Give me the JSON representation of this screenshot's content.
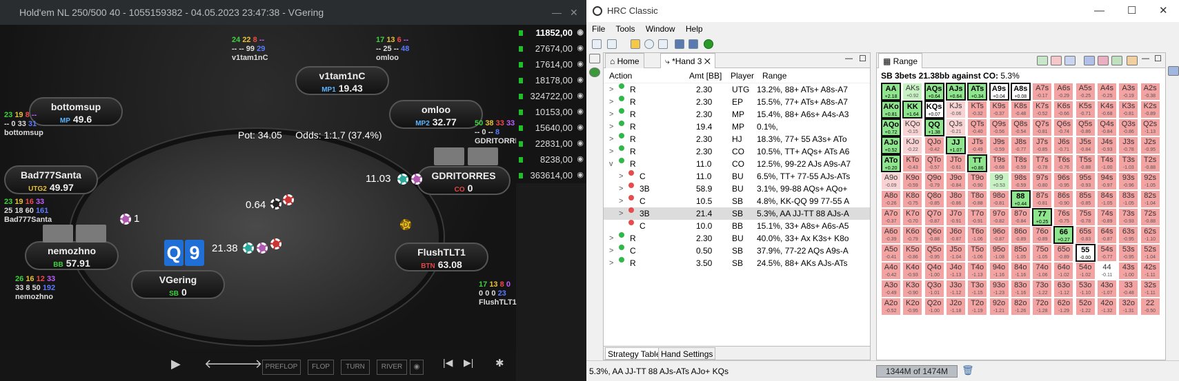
{
  "poker": {
    "title": "Hold'em NL 250/500 40 - 1055159382 - 04.05.2023 23:47:38 - VGering",
    "win_min": "—",
    "win_close": "✕",
    "pot_label": "Pot:  34.05",
    "odds_label": "Odds:  1:1.7 (37.4%)",
    "seats": [
      {
        "name": "v1tam1nC",
        "pos": "MP1",
        "stack": "19.43"
      },
      {
        "name": "omloo",
        "pos": "MP2",
        "stack": "32.77"
      },
      {
        "name": "bottomsup",
        "pos": "MP",
        "stack": "49.6"
      },
      {
        "name": "Bad777Santa",
        "pos": "UTG2",
        "stack": "49.97"
      },
      {
        "name": "GDRITORRES",
        "pos": "CO",
        "stack": "0"
      },
      {
        "name": "nemozhno",
        "pos": "BB",
        "stack": "57.91"
      },
      {
        "name": "VGering",
        "pos": "SB",
        "stack": "0"
      },
      {
        "name": "FlushTLT1",
        "pos": "BTN",
        "stack": "63.08"
      }
    ],
    "stats": {
      "v1tam1nC": {
        "a": "24",
        "b": "22",
        "c": "8",
        "d": "--",
        "e": "--",
        "f": "--",
        "g": "99",
        "h": "29",
        "name": "v1tam1nC"
      },
      "omloo": {
        "a": "17",
        "b": "13",
        "c": "6",
        "d": "--",
        "e": "--",
        "f": "25",
        "g": "--",
        "h": "48",
        "name": "omloo"
      },
      "bottomsup": {
        "a": "23",
        "b": "19",
        "c": "8",
        "d": "--",
        "e": "--",
        "f": "0",
        "g": "33",
        "h": "31",
        "name": "bottomsup"
      },
      "gdri": {
        "a": "50",
        "b": "38",
        "c": "33",
        "d": "33",
        "e": "--",
        "f": "0",
        "g": "--",
        "h": "8",
        "name": "GDRITORRES"
      },
      "bad": {
        "a": "23",
        "b": "19",
        "c": "16",
        "d": "33",
        "e": "25",
        "f": "18",
        "g": "60",
        "h": "161",
        "name": "Bad777Santa"
      },
      "nemo": {
        "a": "26",
        "b": "16",
        "c": "12",
        "d": "33",
        "e": "33",
        "f": "8",
        "g": "50",
        "h": "192",
        "name": "nemozhno"
      },
      "flush": {
        "a": "17",
        "b": "13",
        "c": "8",
        "d": "0",
        "e": "0",
        "f": "0",
        "g": "0",
        "h": "23",
        "name": "FlushTLT1"
      }
    },
    "bets": {
      "gdri": "11.03",
      "center": "0.64",
      "bad": "1",
      "vg": "21.38"
    },
    "hole_cards": [
      "Q",
      "9"
    ],
    "stack_list": [
      "11852,00",
      "27674,00",
      "17614,00",
      "18178,00",
      "324722,00",
      "10153,00",
      "15640,00",
      "22831,00",
      "8238,00",
      "363614,00"
    ],
    "controls": {
      "play": "▶",
      "back": "🡐",
      "fwd": "🡒",
      "preflop": "PREFLOP",
      "flop": "FLOP",
      "turn": "TURN",
      "river": "RIVER",
      "eye": "◉",
      "first": "|◀",
      "last": "▶|",
      "gear": "✱"
    },
    "dealer_button": "D"
  },
  "hrc": {
    "title": "HRC Classic",
    "win_min": "—",
    "win_max": "☐",
    "win_close": "✕",
    "menu": [
      "File",
      "Tools",
      "Window",
      "Help"
    ],
    "tabs": {
      "home": "Home",
      "hand": "*Hand 3",
      "close": "✕",
      "range": "Range"
    },
    "columns": [
      "Action",
      "Amt [BB]",
      "Player",
      "Range"
    ],
    "rows": [
      {
        "exp": ">",
        "dot": "green",
        "act": "R",
        "amt": "2.30",
        "pl": "UTG",
        "rng": "13.2%, 88+ ATs+ A8s-A7"
      },
      {
        "exp": ">",
        "dot": "green",
        "act": "R",
        "amt": "2.30",
        "pl": "EP",
        "rng": "15.5%, 77+ ATs+ A8s-A7"
      },
      {
        "exp": ">",
        "dot": "green",
        "act": "R",
        "amt": "2.30",
        "pl": "MP",
        "rng": "15.4%, 88+ A6s+ A4s-A3"
      },
      {
        "exp": ">",
        "dot": "green",
        "act": "R",
        "amt": "19.4",
        "pl": "MP",
        "rng": "0.1%,"
      },
      {
        "exp": ">",
        "dot": "green",
        "act": "R",
        "amt": "2.30",
        "pl": "HJ",
        "rng": "18.3%, 77+ 55 A3s+ ATo"
      },
      {
        "exp": ">",
        "dot": "green",
        "act": "R",
        "amt": "2.30",
        "pl": "CO",
        "rng": "10.5%, TT+ AQs+ ATs A6"
      },
      {
        "exp": "v",
        "dot": "green",
        "act": "R",
        "amt": "11.0",
        "pl": "CO",
        "rng": "12.5%, 99-22 AJs A9s-A7"
      },
      {
        "exp": ">",
        "dot": "red",
        "act": "C",
        "amt": "11.0",
        "pl": "BU",
        "rng": "6.5%, TT+ 77-55 AJs-ATs",
        "ind": 1
      },
      {
        "exp": ">",
        "dot": "red",
        "act": "3B",
        "amt": "58.9",
        "pl": "BU",
        "rng": "3.1%, 99-88 AQs+ AQo+",
        "ind": 1
      },
      {
        "exp": ">",
        "dot": "red",
        "act": "C",
        "amt": "10.5",
        "pl": "SB",
        "rng": "4.8%, KK-QQ 99 77-55 A",
        "ind": 1
      },
      {
        "exp": ">",
        "dot": "red",
        "act": "3B",
        "amt": "21.4",
        "pl": "SB",
        "rng": "5.3%, AA JJ-TT 88 AJs-A",
        "ind": 1,
        "sel": true
      },
      {
        "exp": "",
        "dot": "red",
        "act": "C",
        "amt": "10.0",
        "pl": "BB",
        "rng": "15.1%, 33+ A8s+ A6s-A5",
        "ind": 1
      },
      {
        "exp": ">",
        "dot": "green",
        "act": "R",
        "amt": "2.30",
        "pl": "BU",
        "rng": "40.0%, 33+ Ax K3s+ K8o"
      },
      {
        "exp": ">",
        "dot": "green",
        "act": "C",
        "amt": "0.50",
        "pl": "SB",
        "rng": "37.9%, 77-22 AQs A9s-A"
      },
      {
        "exp": ">",
        "dot": "green",
        "act": "R",
        "amt": "3.50",
        "pl": "SB",
        "rng": "24.5%, 88+ AKs AJs-ATs"
      }
    ],
    "bottom_tabs": [
      "Strategy Table",
      "Hand Settings"
    ],
    "range_title": "SB 3bets 21.38bb against CO:",
    "range_pct": "5.3%",
    "status": "5.3%, AA JJ-TT 88 AJs-ATs AJo+ KQs",
    "memory": "1344M of 1474M",
    "grid": [
      [
        "AA|+2.18|g",
        "AKs|+0.92|lg",
        "AQs|+0.64|g",
        "AJs|+0.64|g",
        "ATs|+0.34|g",
        "A9s|+0.04|w",
        "A8s|+0.08|w",
        "A7s|-0.17|p",
        "A6s|-0.29|p",
        "A5s|-0.25|p",
        "A4s|-0.25|p",
        "A3s|-0.19|p",
        "A2s|-0.38|p"
      ],
      [
        "AKo|+0.81|g",
        "KK|+1.64|g",
        "KQs|+0.07|w",
        "KJs|-0.06|lp",
        "KTs|-0.32|p",
        "K9s|-0.37|p",
        "K8s|-0.48|p",
        "K7s|-0.52|p",
        "K6s|-0.66|p",
        "K5s|-0.71|p",
        "K4s|-0.68|p",
        "K3s|-0.81|p",
        "K2s|-0.89|p"
      ],
      [
        "AQo|+0.72|g",
        "KQo|-0.15|lp",
        "QQ|+1.38|g",
        "QJs|-0.21|lp",
        "QTs|-0.40|p",
        "Q9s|-0.56|p",
        "Q8s|-0.54|p",
        "Q7s|-0.81|p",
        "Q6s|-0.74|p",
        "Q5s|-0.86|p",
        "Q4s|-0.84|p",
        "Q3s|-0.86|p",
        "Q2s|-1.13|p"
      ],
      [
        "AJo|+0.52|g",
        "KJo|-0.22|lp",
        "QJo|-0.42|p",
        "JJ|+1.07|g",
        "JTs|-0.49|p",
        "J9s|-0.59|p",
        "J8s|-0.77|p",
        "J7s|-0.85|p",
        "J6s|-0.71|p",
        "J5s|-0.84|p",
        "J4s|-0.93|p",
        "J3s|-0.78|p",
        "J2s|-0.95|p"
      ],
      [
        "ATo|+0.20|g",
        "KTo|-0.43|p",
        "QTo|-0.57|p",
        "JTo|-0.61|p",
        "TT|+0.86|g",
        "T9s|-0.68|p",
        "T8s|-0.59|p",
        "T7s|-0.78|p",
        "T6s|-0.76|p",
        "T5s|-0.88|p",
        "T4s|-1.00|p",
        "T3s|-1.03|p",
        "T2s|-0.88|p"
      ],
      [
        "A9o|-0.09|lp",
        "K9o|-0.59|p",
        "Q9o|-0.79|p",
        "J9o|-0.84|p",
        "T9o|-0.90|p",
        "99|+0.53|lg",
        "98s|-0.59|p",
        "97s|-0.80|p",
        "96s|-0.95|p",
        "95s|-0.93|p",
        "94s|-0.97|p",
        "93s|-0.96|p",
        "92s|-1.05|p"
      ],
      [
        "A8o|-0.26|p",
        "K8o|-0.75|p",
        "Q8o|-0.85|p",
        "J8o|-0.86|p",
        "T8o|-0.88|p",
        "98o|-0.81|p",
        "88|+0.44|g",
        "87s|-0.81|p",
        "86s|-0.90|p",
        "85s|-0.85|p",
        "84s|-1.05|p",
        "83s|-1.05|p",
        "82s|-1.04|p"
      ],
      [
        "A7o|-0.37|p",
        "K7o|-0.70|p",
        "Q7o|-0.87|p",
        "J7o|-0.91|p",
        "T7o|-0.91|p",
        "97o|-0.82|p",
        "87o|-0.84|p",
        "77|+0.25|g",
        "76s|-0.75|p",
        "75s|-0.78|p",
        "74s|-0.89|p",
        "73s|-0.93|p",
        "72s|-0.88|p"
      ],
      [
        "A6o|-0.39|p",
        "K6o|-0.79|p",
        "Q6o|-0.88|p",
        "J6o|-0.87|p",
        "T6o|-1.06|p",
        "96o|-0.87|p",
        "86o|-0.89|p",
        "76o|-0.89|p",
        "66|+0.27|g",
        "65s|-0.83|p",
        "64s|-0.87|p",
        "63s|-0.95|p",
        "62s|-1.10|p"
      ],
      [
        "A5o|-0.41|p",
        "K5o|-0.86|p",
        "Q5o|-0.95|p",
        "J5o|-1.04|p",
        "T5o|-1.06|p",
        "95o|-1.08|p",
        "85o|-1.05|p",
        "75o|-1.05|p",
        "65o|-0.89|p",
        "55|-0.00|w",
        "54s|-0.77|p",
        "53s|-0.95|p",
        "52s|-1.04|p"
      ],
      [
        "A4o|-0.42|p",
        "K4o|-0.93|p",
        "Q4o|-1.00|p",
        "J4o|-1.13|p",
        "T4o|-1.13|p",
        "94o|-1.16|p",
        "84o|-1.16|p",
        "74o|-1.06|p",
        "64o|-1.02|p",
        "54o|-1.02|p",
        "44|-0.11|w",
        "43s|-1.00|p",
        "42s|-1.11|p"
      ],
      [
        "A3o|-0.49|p",
        "K3o|-0.90|p",
        "Q3o|-1.01|p",
        "J3o|-1.12|p",
        "T3o|-1.15|p",
        "93o|-1.23|p",
        "83o|-1.16|p",
        "73o|-1.22|p",
        "63o|-1.12|p",
        "53o|-1.10|p",
        "43o|-1.07|p",
        "33|-0.48|p",
        "32s|-1.11|p"
      ],
      [
        "A2o|-0.52|p",
        "K2o|-0.95|p",
        "Q2o|-1.00|p",
        "J2o|-1.18|p",
        "T2o|-1.19|p",
        "92o|-1.21|p",
        "82o|-1.26|p",
        "72o|-1.28|p",
        "62o|-1.29|p",
        "52o|-1.22|p",
        "42o|-1.32|p",
        "32o|-1.31|p",
        "22|-0.50|p"
      ]
    ],
    "in_range": [
      "AA",
      "AKo",
      "KK",
      "AQs",
      "KQs",
      "QQ",
      "AJs",
      "ATs",
      "JJ",
      "A9s",
      "A8s",
      "AQo",
      "AJo",
      "ATo",
      "TT",
      "88",
      "77",
      "66",
      "55"
    ],
    "colors": {
      "green": "#8ee58e",
      "lightgreen": "#c9f2c4",
      "pink": "#f4a3a3",
      "lightpink": "#f9d3d3",
      "white": "#ffffff"
    }
  }
}
